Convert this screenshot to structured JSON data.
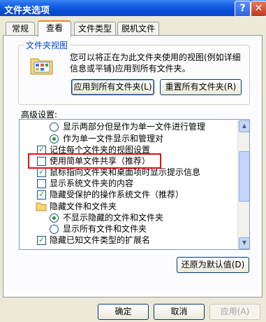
{
  "window": {
    "title": "文件夹选项",
    "help_label": "?",
    "close_label": "✕"
  },
  "tabs": [
    "常规",
    "查看",
    "文件类型",
    "脱机文件"
  ],
  "folder_views": {
    "title": "文件夹视图",
    "description": "您可以将正在为此文件夹使用的视图(例如详细信息或平铺)应用到所有文件夹。",
    "apply_all_label": "应用到所有文件夹(L)",
    "reset_all_label": "重置所有文件夹(R)"
  },
  "advanced": {
    "label": "高级设置:",
    "items": [
      {
        "type": "radio",
        "checked": false,
        "indent": 1,
        "label": "显示两部分但是作为单一文件进行管理"
      },
      {
        "type": "radio",
        "checked": true,
        "indent": 1,
        "label": "作为单一文件显示和管理对"
      },
      {
        "type": "checkbox",
        "checked": true,
        "indent": 0,
        "label": "记住每个文件夹的视图设置"
      },
      {
        "type": "checkbox",
        "checked": false,
        "indent": 0,
        "label": "使用简单文件共享（推荐）"
      },
      {
        "type": "checkbox",
        "checked": true,
        "indent": 0,
        "label": "鼠标指向文件夹和桌面项时显示提示信息"
      },
      {
        "type": "checkbox",
        "checked": false,
        "indent": 0,
        "label": "显示系统文件夹的内容"
      },
      {
        "type": "checkbox",
        "checked": true,
        "indent": 0,
        "label": "隐藏受保护的操作系统文件（推荐）"
      },
      {
        "type": "folder",
        "indent": 0,
        "label": "隐藏文件和文件夹"
      },
      {
        "type": "radio",
        "checked": true,
        "indent": 1,
        "label": "不显示隐藏的文件和文件夹"
      },
      {
        "type": "radio",
        "checked": false,
        "indent": 1,
        "label": "显示所有文件和文件夹"
      },
      {
        "type": "checkbox",
        "checked": true,
        "indent": 0,
        "label": "隐藏已知文件类型的扩展名"
      }
    ],
    "restore_defaults_label": "还原为默认值(D)"
  },
  "footer": {
    "ok_label": "确定",
    "cancel_label": "取消",
    "apply_label": "应用(A)"
  }
}
